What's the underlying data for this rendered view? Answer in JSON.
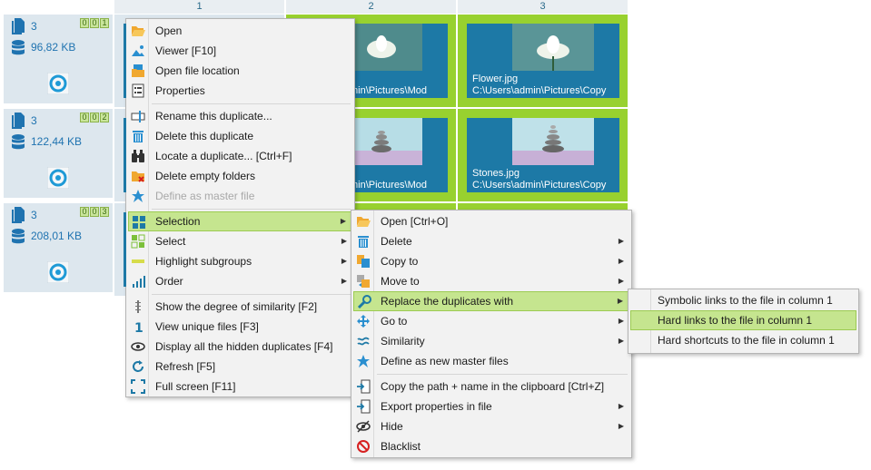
{
  "columns": [
    "1",
    "2",
    "3"
  ],
  "rows": [
    {
      "count": "3",
      "size": "96,82 KB",
      "badge": [
        "0",
        "0",
        "1"
      ]
    },
    {
      "count": "3",
      "size": "122,44 KB",
      "badge": [
        "0",
        "0",
        "2"
      ]
    },
    {
      "count": "3",
      "size": "208,01 KB",
      "badge": [
        "0",
        "0",
        "3"
      ]
    }
  ],
  "cells": [
    {
      "name": "Flower.jpg",
      "path": "C:\\Users\\admin\\Pictures\\Copy",
      "partial_path": "min\\Pictures\\Mod"
    },
    {
      "name": "Stones.jpg",
      "path": "C:\\Users\\admin\\Pictures\\Copy",
      "partial_path": "min\\Pictures\\Mod"
    }
  ],
  "context_menu": {
    "items": [
      {
        "label": "Open",
        "icon": "folder-open-icon"
      },
      {
        "label": "Viewer  [F10]",
        "icon": "image-icon"
      },
      {
        "label": "Open file location",
        "icon": "folder-location-icon"
      },
      {
        "label": "Properties",
        "icon": "properties-icon"
      },
      {
        "label": "Rename this duplicate...",
        "icon": "rename-icon"
      },
      {
        "label": "Delete this duplicate",
        "icon": "trash-icon"
      },
      {
        "label": "Locate a duplicate...  [Ctrl+F]",
        "icon": "binoculars-icon"
      },
      {
        "label": "Delete empty folders",
        "icon": "folder-delete-icon"
      },
      {
        "label": "Define as master file",
        "icon": "star-icon"
      },
      {
        "label": "Selection",
        "icon": "grid-select-icon"
      },
      {
        "label": "Select",
        "icon": "select-icon"
      },
      {
        "label": "Highlight subgroups",
        "icon": "highlight-icon"
      },
      {
        "label": "Order",
        "icon": "bars-icon"
      },
      {
        "label": "Show the degree of similarity  [F2]",
        "icon": "similarity-degree-icon"
      },
      {
        "label": "View unique files  [F3]",
        "icon": "one-icon"
      },
      {
        "label": "Display all the hidden duplicates  [F4]",
        "icon": "eye-icon"
      },
      {
        "label": "Refresh  [F5]",
        "icon": "refresh-icon"
      },
      {
        "label": "Full screen  [F11]",
        "icon": "fullscreen-icon"
      }
    ]
  },
  "selection_menu": {
    "items": [
      {
        "label": "Open  [Ctrl+O]",
        "icon": "folder-open-icon"
      },
      {
        "label": "Delete",
        "icon": "trash-icon"
      },
      {
        "label": "Copy to",
        "icon": "copy-icon"
      },
      {
        "label": "Move to",
        "icon": "move-icon"
      },
      {
        "label": "Replace the duplicates with",
        "icon": "wrench-icon"
      },
      {
        "label": "Go to",
        "icon": "goto-icon"
      },
      {
        "label": "Similarity",
        "icon": "approx-icon"
      },
      {
        "label": "Define as new master files",
        "icon": "star-icon"
      },
      {
        "label": "Copy the path + name in the clipboard  [Ctrl+Z]",
        "icon": "clipboard-path-icon"
      },
      {
        "label": "Export properties in file",
        "icon": "export-icon"
      },
      {
        "label": "Hide",
        "icon": "hide-eye-icon"
      },
      {
        "label": "Blacklist",
        "icon": "blacklist-icon"
      }
    ]
  },
  "replace_menu": {
    "items": [
      {
        "label": "Symbolic links to the file in column 1"
      },
      {
        "label": "Hard links to the file in column 1"
      },
      {
        "label": "Hard shortcuts to the file in column 1"
      }
    ]
  },
  "colors": {
    "accent_green": "#98d12f",
    "highlight": "#c5e58f",
    "blue": "#1d79a6",
    "panel": "#dde7ee"
  }
}
